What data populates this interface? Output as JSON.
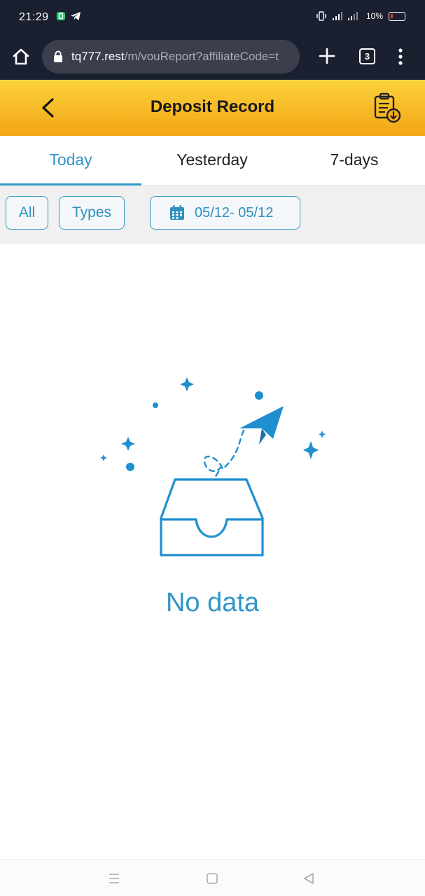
{
  "status_bar": {
    "time": "21:29",
    "battery": "10%",
    "icons": [
      "app-notification-icon",
      "telegram-icon",
      "vibrate-icon",
      "signal-icon",
      "battery-icon"
    ]
  },
  "browser": {
    "url_host": "tq777.rest",
    "url_path": "/m/vouReport?affiliateCode=t",
    "tab_count": "3"
  },
  "header": {
    "title": "Deposit Record"
  },
  "tabs": [
    {
      "label": "Today",
      "active": true
    },
    {
      "label": "Yesterday",
      "active": false
    },
    {
      "label": "7-days",
      "active": false
    }
  ],
  "filters": {
    "all_label": "All",
    "types_label": "Types",
    "date_range": "05/12- 05/12"
  },
  "empty_state": {
    "text": "No data"
  },
  "colors": {
    "accent": "#2f96c8",
    "header_top": "#fbd23b",
    "header_bottom": "#f2a515",
    "dark_bar": "#1b2030"
  }
}
